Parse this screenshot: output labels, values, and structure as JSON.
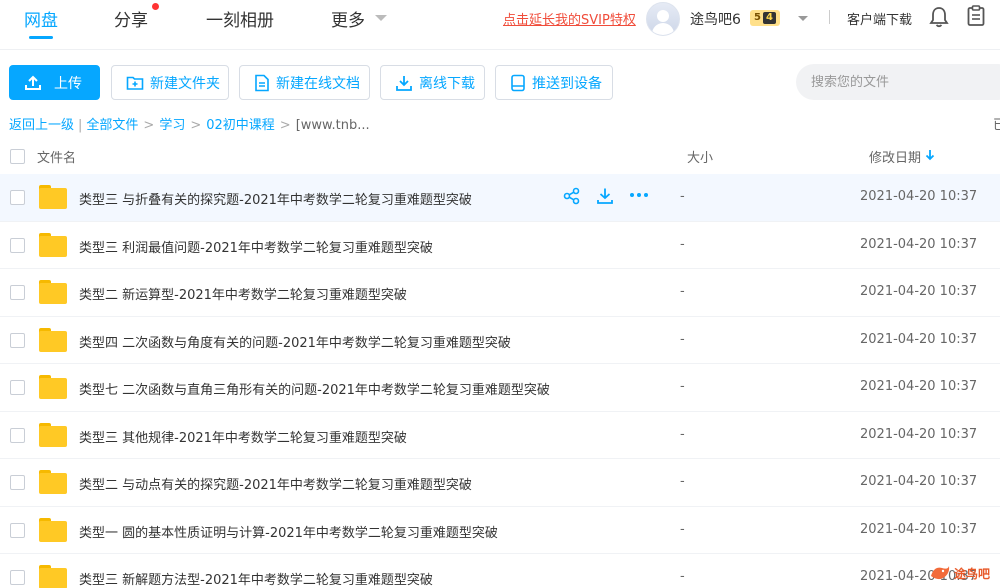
{
  "nav": {
    "tabs": [
      {
        "label": "网盘",
        "active": true
      },
      {
        "label": "分享",
        "has_dot": true
      },
      {
        "label": "一刻相册"
      },
      {
        "label": "更多"
      }
    ],
    "svip_link": "点击延长我的SVIP特权",
    "username": "途鸟吧6",
    "level_left": "5",
    "level_right": "4",
    "client_download": "客户端下载",
    "icons": [
      "bell-icon",
      "clipboard-icon",
      "user-avatar"
    ]
  },
  "toolbar": {
    "upload": "上传",
    "new_folder": "新建文件夹",
    "new_doc": "新建在线文档",
    "offline_download": "离线下载",
    "push_device": "推送到设备",
    "search_placeholder": "搜索您的文件"
  },
  "breadcrumb": {
    "back": "返回上一级",
    "items": [
      "全部文件",
      "学习",
      "02初中课程"
    ],
    "current": "[www.tnb...",
    "tail": "已"
  },
  "table": {
    "headers": {
      "name": "文件名",
      "size": "大小",
      "date": "修改日期"
    },
    "sort": "修改日期 descending",
    "rows": [
      {
        "name": "类型三 与折叠有关的探究题-2021年中考数学二轮复习重难题型突破",
        "size": "-",
        "date": "2021-04-20 10:37"
      },
      {
        "name": "类型三 利润最值问题-2021年中考数学二轮复习重难题型突破",
        "size": "-",
        "date": "2021-04-20 10:37"
      },
      {
        "name": "类型二 新运算型-2021年中考数学二轮复习重难题型突破",
        "size": "-",
        "date": "2021-04-20 10:37"
      },
      {
        "name": "类型四 二次函数与角度有关的问题-2021年中考数学二轮复习重难题型突破",
        "size": "-",
        "date": "2021-04-20 10:37"
      },
      {
        "name": "类型七 二次函数与直角三角形有关的问题-2021年中考数学二轮复习重难题型突破",
        "size": "-",
        "date": "2021-04-20 10:37"
      },
      {
        "name": "类型三 其他规律-2021年中考数学二轮复习重难题型突破",
        "size": "-",
        "date": "2021-04-20 10:37"
      },
      {
        "name": "类型二 与动点有关的探究题-2021年中考数学二轮复习重难题型突破",
        "size": "-",
        "date": "2021-04-20 10:37"
      },
      {
        "name": "类型一 圆的基本性质证明与计算-2021年中考数学二轮复习重难题型突破",
        "size": "-",
        "date": "2021-04-20 10:37"
      },
      {
        "name": "类型三 新解题方法型-2021年中考数学二轮复习重难题型突破",
        "size": "-",
        "date": "2021-04-20 10:37"
      }
    ],
    "row_actions": [
      "share-icon",
      "download-icon",
      "more-icon"
    ]
  },
  "watermark": "途鸟吧",
  "colors": {
    "accent": "#06a7ff",
    "svip": "#f04c3a",
    "folder": "#ffc925",
    "hover_row": "#f3f8ff"
  }
}
